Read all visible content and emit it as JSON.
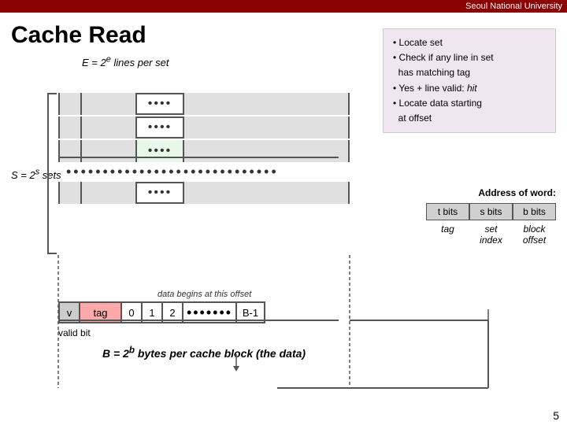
{
  "topbar": {
    "university": "Seoul National University"
  },
  "title": "Cache Read",
  "info_box": {
    "lines": [
      "• Locate set",
      "• Check if any line in set",
      "  has matching tag",
      "• Yes + line valid: hit",
      "• Locate data starting",
      "  at offset"
    ]
  },
  "e_label": "E = 2e lines per set",
  "s_label": "S = 2s sets",
  "address": {
    "label": "Address of word:",
    "bits": [
      "t bits",
      "s bits",
      "b bits"
    ],
    "labels": [
      "tag",
      "set\nindex",
      "block\noffset"
    ]
  },
  "expanded_row": {
    "v": "v",
    "tag": "tag",
    "cells": [
      "0",
      "1",
      "2"
    ],
    "dots": "•••••••",
    "b1": "B-1"
  },
  "valid_bit_label": "valid bit",
  "b_label": "B = 2b bytes per cache block (the data)",
  "data_offset_label": "data begins at this offset",
  "page_num": "5"
}
